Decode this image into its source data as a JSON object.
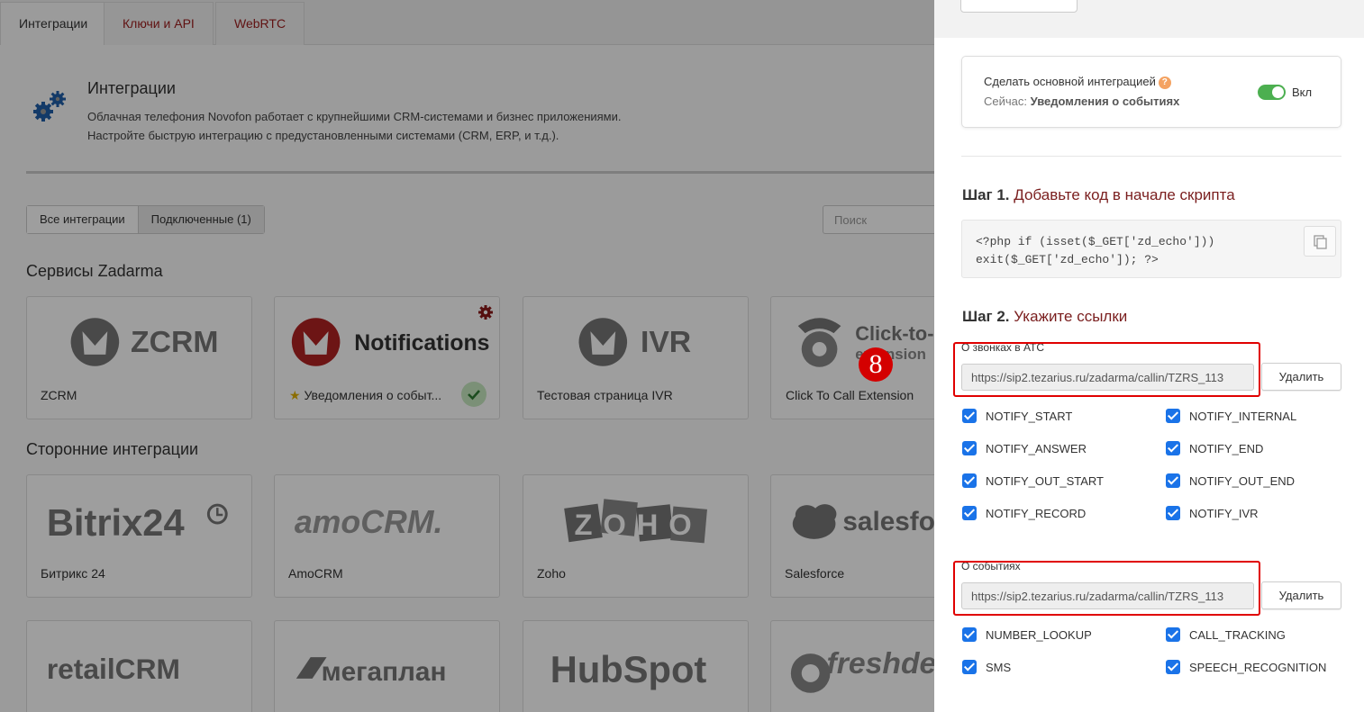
{
  "tabs": [
    {
      "label": "Интеграции"
    },
    {
      "label": "Ключи и API"
    },
    {
      "label": "WebRTC"
    }
  ],
  "intro": {
    "title": "Интеграции",
    "line1": "Облачная телефония Novofon работает с крупнейшими CRM-системами и бизнес приложениями.",
    "line2": "Настройте быструю интеграцию с предустановленными системами (CRM, ERP, и т.д.)."
  },
  "filter": {
    "all": "Все интеграции",
    "connected": "Подключенные (1)"
  },
  "search": {
    "placeholder": "Поиск"
  },
  "sections": {
    "services": "Сервисы Zadarma",
    "third_party": "Сторонние интеграции"
  },
  "cards": {
    "zcrm": {
      "logo": "ZCRM",
      "name": "ZCRM"
    },
    "notifications": {
      "logo": "Notifications",
      "name": "Уведомления о событ..."
    },
    "ivr": {
      "logo": "IVR",
      "name": "Тестовая страница IVR"
    },
    "click": {
      "logo1": "Click-to-",
      "logo2": "extension",
      "name": "Click To Call Extension"
    },
    "bitrix": {
      "logo": "Bitrix24",
      "name": "Битрикс 24"
    },
    "amocrm": {
      "logo": "amoCRM.",
      "name": "AmoCRM"
    },
    "zoho": {
      "logo": "ZOHO",
      "name": "Zoho"
    },
    "salesforce": {
      "logo": "salesfo",
      "name": "Salesforce"
    },
    "retailcrm": {
      "logo": "retailCRM"
    },
    "megaplan": {
      "logo": "мегаплан"
    },
    "hubspot": {
      "logo": "HubSpot"
    },
    "freshdesk": {
      "logo": "freshde"
    }
  },
  "step_badge": "8",
  "panel": {
    "main_title": "Сделать основной интеграцией",
    "help": "?",
    "current_prefix": "Сейчас:",
    "current_value": "Уведомления о событиях",
    "toggle_label": "Вкл",
    "step1_prefix": "Шаг 1.",
    "step1_text": "Добавьте код в начале скрипта",
    "code": "<?php if (isset($_GET['zd_echo']))\nexit($_GET['zd_echo']); ?>",
    "step2_prefix": "Шаг 2.",
    "step2_text": "Укажите ссылки",
    "calls_label": "О звонках в АТС",
    "calls_url": "https://sip2.tezarius.ru/zadarma/callin/TZRS_113",
    "events_label": "О событиях",
    "events_url": "https://sip2.tezarius.ru/zadarma/callin/TZRS_113",
    "delete": "Удалить",
    "calls_checks": [
      "NOTIFY_START",
      "NOTIFY_INTERNAL",
      "NOTIFY_ANSWER",
      "NOTIFY_END",
      "NOTIFY_OUT_START",
      "NOTIFY_OUT_END",
      "NOTIFY_RECORD",
      "NOTIFY_IVR"
    ],
    "events_checks": [
      "NUMBER_LOOKUP",
      "CALL_TRACKING",
      "SMS",
      "SPEECH_RECOGNITION"
    ]
  },
  "colors": {
    "accent": "#9b1c1c",
    "checkbox": "#1a73e8",
    "toggle_on": "#4caf50",
    "highlight": "#e00000"
  }
}
